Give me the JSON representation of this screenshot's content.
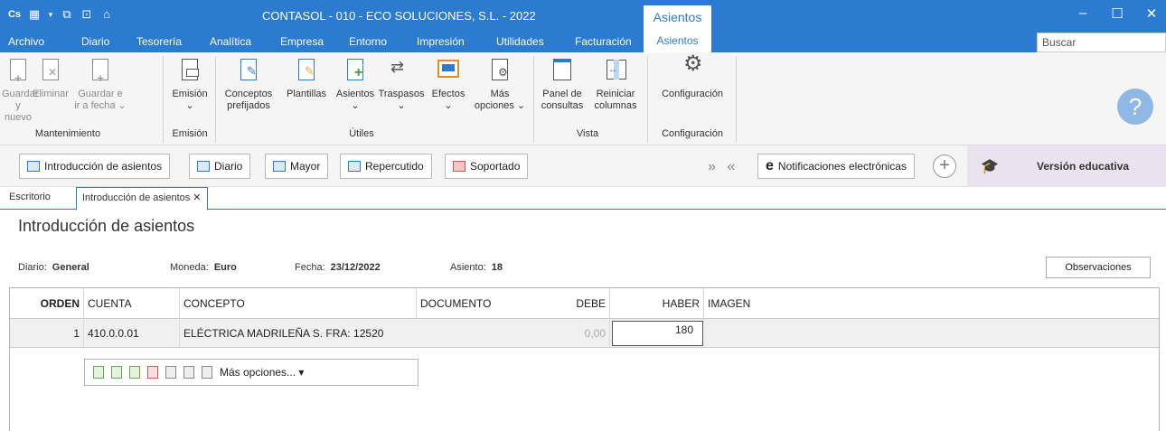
{
  "titlebar": {
    "title": "CONTASOL - 010 - ECO SOLUCIONES, S.L. - 2022",
    "context_tab": "Asientos",
    "logo": "Cs",
    "min": "–",
    "max": "☐",
    "close": "✕"
  },
  "menu": {
    "items": [
      "Archivo",
      "Diario",
      "Tesorería",
      "Analítica",
      "Empresa",
      "Entorno",
      "Impresión",
      "Utilidades",
      "Facturación"
    ],
    "active": "Asientos",
    "search_placeholder": "Buscar"
  },
  "ribbon": {
    "mantenimiento": {
      "label": "Mantenimiento",
      "buttons": [
        {
          "l1": "Guardar",
          "l2": "y nuevo"
        },
        {
          "l1": "Eliminar",
          "l2": ""
        },
        {
          "l1": "Guardar e",
          "l2": "ir a fecha ⌄"
        }
      ]
    },
    "emision": {
      "label": "Emisión",
      "button": "Emisión",
      "arrow": "⌄"
    },
    "utiles": {
      "label": "Útiles",
      "buttons": [
        {
          "l1": "Conceptos",
          "l2": "prefijados"
        },
        {
          "l1": "Plantillas",
          "l2": ""
        },
        {
          "l1": "Asientos",
          "l2": "⌄"
        },
        {
          "l1": "Traspasos",
          "l2": "⌄"
        },
        {
          "l1": "Efectos",
          "l2": "⌄"
        },
        {
          "l1": "Más",
          "l2": "opciones ⌄"
        }
      ]
    },
    "vista": {
      "label": "Vista",
      "buttons": [
        {
          "l1": "Panel de",
          "l2": "consultas"
        },
        {
          "l1": "Reiniciar",
          "l2": "columnas"
        }
      ]
    },
    "configuracion": {
      "label": "Configuración",
      "button": "Configuración"
    },
    "help": "?"
  },
  "shortcuts": {
    "items": [
      "Introducción de asientos",
      "Diario",
      "Mayor",
      "Repercutido",
      "Soportado"
    ],
    "arrows": "» «",
    "notif": "Notificaciones electrónicas",
    "notif_icon": "e",
    "plus": "+",
    "edu_icon": "🎓",
    "edu": "Versión educativa"
  },
  "tabs": {
    "escritorio": "Escritorio",
    "active": "Introducción de asientos ✕"
  },
  "page_title": "Introducción de asientos",
  "header": {
    "diario_label": "Diario:",
    "diario": "General",
    "moneda_label": "Moneda:",
    "moneda": "Euro",
    "fecha_label": "Fecha:",
    "fecha": "23/12/2022",
    "asiento_label": "Asiento:",
    "asiento": "18",
    "observaciones": "Observaciones"
  },
  "grid": {
    "columns": [
      "ORDEN",
      "CUENTA",
      "CONCEPTO",
      "DOCUMENTO",
      "DEBE",
      "HABER",
      "IMAGEN"
    ],
    "rows": [
      {
        "orden": "1",
        "cuenta": "410.0.0.01",
        "concepto": "ELÉCTRICA MADRILEÑA S. FRA: 12520",
        "documento": "",
        "debe": "0,00",
        "haber": "180",
        "imagen": ""
      }
    ],
    "toolbar_more": "Más opciones... ▾"
  }
}
